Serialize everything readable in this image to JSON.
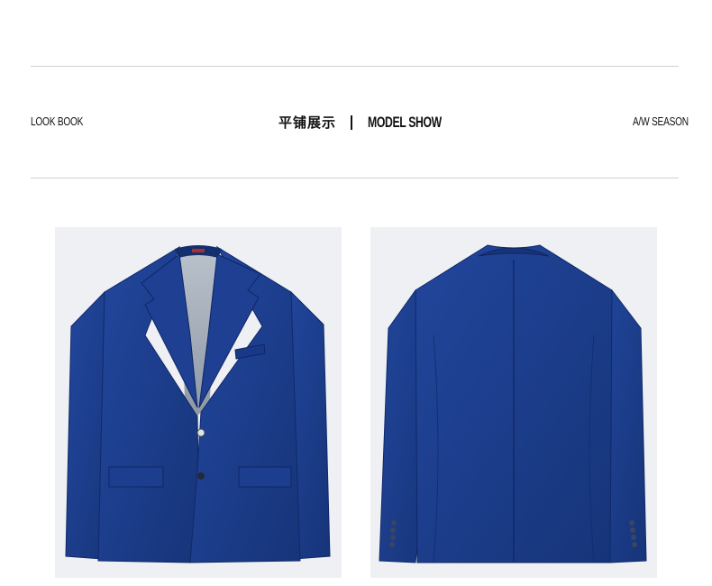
{
  "header": {
    "left_label": "LOOK BOOK",
    "center_cn": "平铺展示",
    "center_en": "MODEL SHOW",
    "right_label": "A/W SEASON"
  },
  "colors": {
    "jacket_blue": "#1a3a8c",
    "lining_grey": "#a9b2bd",
    "photo_background": "#eef0f3",
    "rule_line": "#cfcfcf"
  },
  "images": [
    {
      "name": "blazer-front-photo",
      "subject": "navy blue blazer, front flat lay"
    },
    {
      "name": "blazer-back-photo",
      "subject": "navy blue blazer, back flat lay"
    }
  ]
}
